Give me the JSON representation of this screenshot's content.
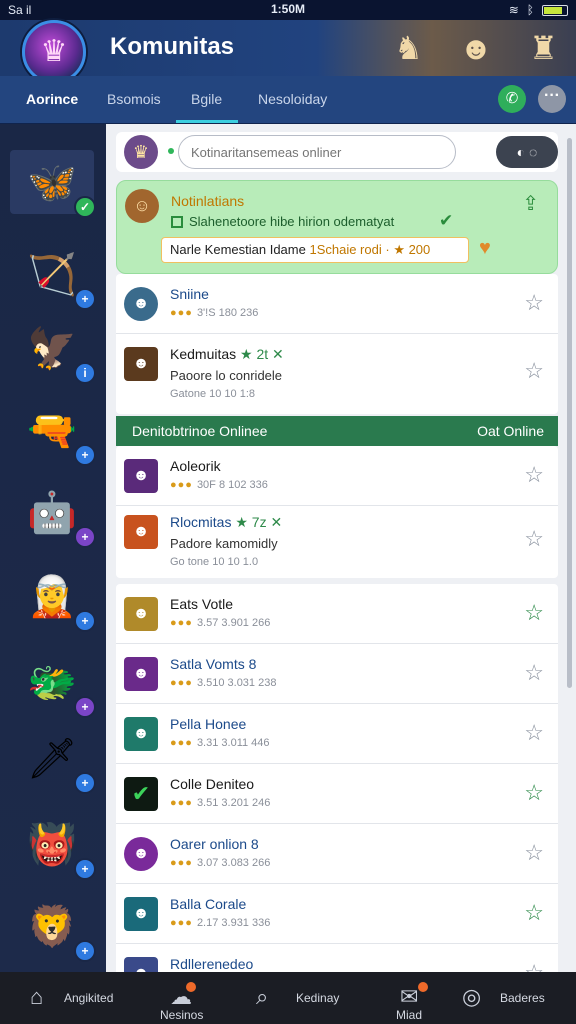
{
  "status_bar": {
    "left": "Sa il",
    "time": "1:50M"
  },
  "header": {
    "title": "Komunitas"
  },
  "tabs": [
    {
      "label": "Aorince"
    },
    {
      "label": "Bsomois"
    },
    {
      "label": "Bgile"
    },
    {
      "label": "Nesoloiday"
    }
  ],
  "icons": {
    "call": "phone-icon",
    "more": "more-icon"
  },
  "search": {
    "placeholder": "Kotinaritansemeas onliner",
    "toggle": "◐ ◌"
  },
  "notification": {
    "title": "Notinlatians",
    "subtitle": "Slahenetoore hibe hirion  odematyat",
    "box_text": "Narle Kemestian Idame",
    "box_highlight": "1Schaie rodi ·",
    "box_score": "★ 200"
  },
  "list_top": [
    {
      "name": "Sniine",
      "coins": "●●●",
      "meta": "3'!S 180  236",
      "star": "outline"
    }
  ],
  "featured_1": {
    "name": "Kedmuitas",
    "badges": "★ 2t ✕",
    "sub": "Paoore lo conridele",
    "time": "Gatone 10 10 1:8"
  },
  "section": {
    "left": "Denitobtrinoe Onlinee",
    "right": "Oat Online"
  },
  "list_mid": [
    {
      "name": "Aoleorik",
      "coins": "●●●",
      "meta": "30F  8 102  336",
      "star": "outline"
    }
  ],
  "featured_2": {
    "name": "Rlocmitas",
    "badges": "★ 7z ✕",
    "sub": "Padore kamomidly",
    "time": "Go tone 10 10 1.0"
  },
  "list_bottom": [
    {
      "name": "Eats Votle",
      "coins": "●●●",
      "meta": "3.57  3.901  266",
      "star": "green"
    },
    {
      "name": "Satla Vomts 8",
      "coins": "●●●",
      "meta": "3.510  3.031  238",
      "star": "outline"
    },
    {
      "name": "Pella Honee",
      "coins": "●●●",
      "meta": "3.31  3.011  446",
      "star": "outline"
    },
    {
      "name": "Colle Deniteo",
      "coins": "●●●",
      "meta": "3.51  3.201  246",
      "star": "green"
    },
    {
      "name": "Oarer onlion 8",
      "coins": "●●●",
      "meta": "3.07  3.083  266",
      "star": "outline"
    },
    {
      "name": "Balla Corale",
      "coins": "●●●",
      "meta": "2.17  3.931  336",
      "star": "green"
    },
    {
      "name": "Rdllerenedeo",
      "coins": "",
      "meta": "",
      "star": "outline"
    }
  ],
  "bottom_nav": [
    {
      "label": "Angikited",
      "icon": "home-icon"
    },
    {
      "label": "Nesinos",
      "icon": "chat-icon"
    },
    {
      "label": "Kedinay",
      "icon": "search-icon"
    },
    {
      "label": "Miad",
      "icon": "mail-icon"
    },
    {
      "label": "Baderes",
      "icon": "profile-icon"
    }
  ],
  "colors": {
    "accent": "#3ccfe0",
    "online": "#2fb65a",
    "section": "#2a7a4e",
    "notification": "#b8ecb9",
    "header": "#23457f"
  }
}
